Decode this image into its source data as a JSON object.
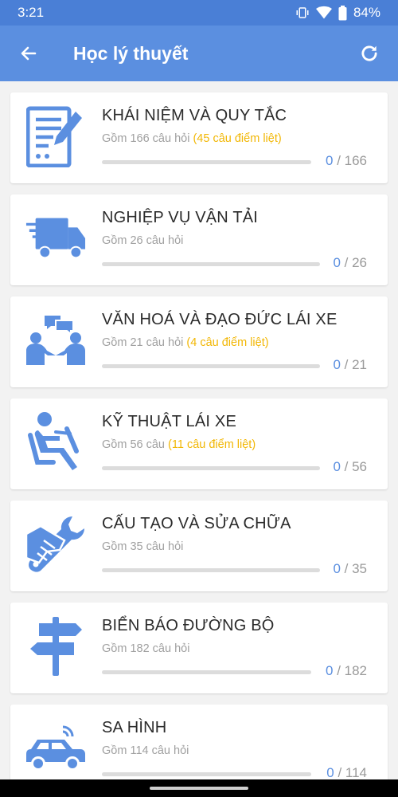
{
  "status": {
    "time": "3:21",
    "battery": "84%"
  },
  "header": {
    "title": "Học lý thuyết"
  },
  "colors": {
    "primary": "#5b8fe0",
    "warning": "#f2b705"
  },
  "topics": [
    {
      "name": "KHÁI NIỆM VÀ QUY TẮC",
      "subtitle": "Gồm 166 câu hỏi",
      "critical": "(45 câu điểm liệt)",
      "done": "0",
      "total": "/ 166",
      "progress": 0,
      "icon": "document-form-icon"
    },
    {
      "name": "NGHIỆP VỤ VẬN TẢI",
      "subtitle": "Gồm 26 câu hỏi",
      "critical": "",
      "done": "0",
      "total": "/ 26",
      "progress": 0,
      "icon": "delivery-truck-icon"
    },
    {
      "name": "VĂN HOÁ VÀ ĐẠO ĐỨC LÁI XE",
      "subtitle": "Gồm 21 câu hỏi",
      "critical": "(4 câu điểm liệt)",
      "done": "0",
      "total": "/ 21",
      "progress": 0,
      "icon": "people-conversation-icon"
    },
    {
      "name": "KỸ THUẬT LÁI XE",
      "subtitle": "Gồm 56 câu",
      "critical": "(11 câu điểm liệt)",
      "done": "0",
      "total": "/ 56",
      "progress": 0,
      "icon": "driver-seat-icon"
    },
    {
      "name": "CẤU TẠO VÀ SỬA CHỮA",
      "subtitle": "Gồm 35 câu hỏi",
      "critical": "",
      "done": "0",
      "total": "/ 35",
      "progress": 0,
      "icon": "wrench-icon"
    },
    {
      "name": "BIỂN BÁO ĐƯỜNG BỘ",
      "subtitle": "Gồm 182 câu hỏi",
      "critical": "",
      "done": "0",
      "total": "/ 182",
      "progress": 0,
      "icon": "signpost-icon"
    },
    {
      "name": "SA HÌNH",
      "subtitle": "Gồm 114 câu hỏi",
      "critical": "",
      "done": "0",
      "total": "/ 114",
      "progress": 0,
      "icon": "connected-car-icon"
    }
  ]
}
